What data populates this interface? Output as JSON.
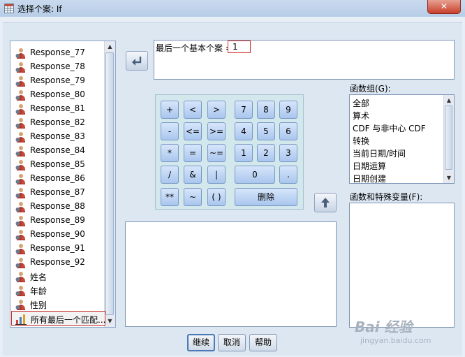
{
  "window": {
    "title": "选择个案: If",
    "close_label": "✕"
  },
  "variables": [
    {
      "label": "Response_77",
      "icon": "nominal-variable-icon"
    },
    {
      "label": "Response_78",
      "icon": "nominal-variable-icon"
    },
    {
      "label": "Response_79",
      "icon": "nominal-variable-icon"
    },
    {
      "label": "Response_80",
      "icon": "nominal-variable-icon"
    },
    {
      "label": "Response_81",
      "icon": "nominal-variable-icon"
    },
    {
      "label": "Response_82",
      "icon": "nominal-variable-icon"
    },
    {
      "label": "Response_83",
      "icon": "nominal-variable-icon"
    },
    {
      "label": "Response_84",
      "icon": "nominal-variable-icon"
    },
    {
      "label": "Response_85",
      "icon": "nominal-variable-icon"
    },
    {
      "label": "Response_86",
      "icon": "nominal-variable-icon"
    },
    {
      "label": "Response_87",
      "icon": "nominal-variable-icon"
    },
    {
      "label": "Response_88",
      "icon": "nominal-variable-icon"
    },
    {
      "label": "Response_89",
      "icon": "nominal-variable-icon"
    },
    {
      "label": "Response_90",
      "icon": "nominal-variable-icon"
    },
    {
      "label": "Response_91",
      "icon": "nominal-variable-icon"
    },
    {
      "label": "Response_92",
      "icon": "nominal-variable-icon"
    },
    {
      "label": "姓名",
      "icon": "nominal-variable-icon"
    },
    {
      "label": "年龄",
      "icon": "nominal-variable-icon"
    },
    {
      "label": "性别",
      "icon": "nominal-variable-icon"
    },
    {
      "label": "所有最后一个匹配...",
      "icon": "bar-chart-icon",
      "selected": true
    }
  ],
  "expression": {
    "label": "最后一个基本个案 = ",
    "value": "1"
  },
  "keypad": [
    [
      "+",
      "<",
      ">",
      "7",
      "8",
      "9"
    ],
    [
      "-",
      "<=",
      ">=",
      "4",
      "5",
      "6"
    ],
    [
      "*",
      "=",
      "~=",
      "1",
      "2",
      "3"
    ],
    [
      "/",
      "&",
      "|",
      "0",
      "."
    ],
    [
      "**",
      "~",
      "( )",
      "删除"
    ]
  ],
  "function_group": {
    "label": "函数组(G):",
    "items": [
      "全部",
      "算术",
      "CDF 与非中心 CDF",
      "转换",
      "当前日期/时间",
      "日期运算",
      "日期创建"
    ]
  },
  "functions_label": "函数和特殊变量(F):",
  "buttons": {
    "continue": "继续",
    "cancel": "取消",
    "help": "帮助"
  },
  "watermark": {
    "main": "Bai 经验",
    "sub": "jingyan.baidu.com"
  },
  "colors": {
    "accent": "#4b79b6",
    "selection_border": "#c8322a"
  }
}
